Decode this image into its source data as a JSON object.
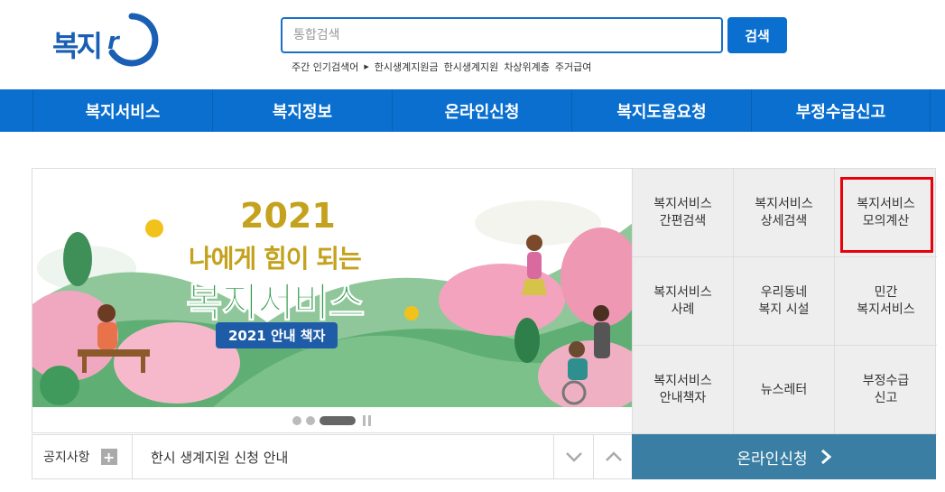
{
  "header": {
    "logo_text": "복지ro",
    "search_placeholder": "통합검색",
    "search_button": "검색",
    "popular_label": "주간 인기검색어",
    "popular_keywords": [
      "한시생계지원금",
      "한시생계지원",
      "차상위계층",
      "주거급여"
    ]
  },
  "nav": [
    "복지서비스",
    "복지정보",
    "온라인신청",
    "복지도움요청",
    "부정수급신고"
  ],
  "banner": {
    "year": "2021",
    "subtitle": "나에게 힘이 되는",
    "title": "복지서비스",
    "badge": "2021 안내 책자"
  },
  "quick_menu": [
    "복지서비스\n간편검색",
    "복지서비스\n상세검색",
    "복지서비스\n모의계산",
    "복지서비스\n사례",
    "우리동네\n복지 시설",
    "민간\n복지서비스",
    "복지서비스\n안내책자",
    "뉴스레터",
    "부정수급\n신고"
  ],
  "notice": {
    "label": "공지사항",
    "text": "한시 생계지원 신청 안내"
  },
  "online_button": "온라인신청",
  "colors": {
    "primary": "#0a6fcf",
    "online": "#3a7fa3",
    "highlight": "#e8000b"
  }
}
